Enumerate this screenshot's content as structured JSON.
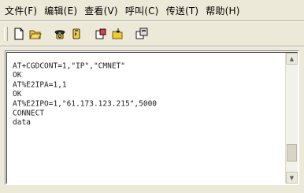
{
  "menubar": {
    "items": [
      {
        "label": "文件(F)"
      },
      {
        "label": "编辑(E)"
      },
      {
        "label": "查看(V)"
      },
      {
        "label": "呼叫(C)"
      },
      {
        "label": "传送(T)"
      },
      {
        "label": "帮助(H)"
      }
    ]
  },
  "toolbar": {
    "buttons": [
      {
        "icon": "new-document-icon"
      },
      {
        "icon": "open-folder-icon"
      },
      {
        "icon": "call-phone-icon"
      },
      {
        "icon": "disconnect-phone-icon"
      },
      {
        "icon": "send-file-icon"
      },
      {
        "icon": "receive-file-icon"
      },
      {
        "icon": "properties-icon"
      }
    ]
  },
  "terminal": {
    "lines": [
      "AT+CGDCONT=1,\"IP\",\"CMNET\"",
      "OK",
      "AT%E2IPA=1,1",
      "OK",
      "AT%E2IPO=1,\"61.173.123.215\",5000",
      "CONNECT",
      "data"
    ]
  },
  "colors": {
    "menubar_bg": "#ece9d8",
    "terminal_bg": "#ffffff",
    "text": "#202020"
  }
}
